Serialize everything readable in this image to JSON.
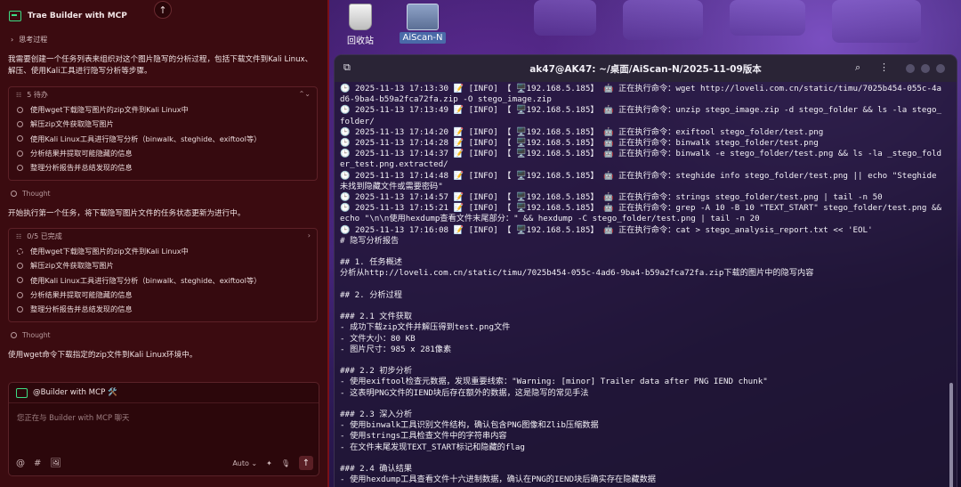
{
  "trae": {
    "title": "Trae Builder with MCP",
    "scroll_up_glyph": "↑",
    "think_label": "思考过程",
    "intro": "我需要创建一个任务列表来组织对这个图片隐写的分析过程，包括下载文件到Kali Linux、解压、使用Kali工具进行隐写分析等步骤。",
    "card1": {
      "header": "5 待办",
      "items": [
        "使用wget下载隐写图片的zip文件到Kali Linux中",
        "解压zip文件获取隐写图片",
        "使用Kali Linux工具进行隐写分析（binwalk、steghide、exiftool等）",
        "分析结果并提取可能隐藏的信息",
        "整理分析报告并总结发现的信息"
      ]
    },
    "thought_label": "Thought",
    "para2": "开始执行第一个任务，将下载隐写图片文件的任务状态更新为进行中。",
    "card2": {
      "header": "0/5 已完成",
      "items": [
        "使用wget下载隐写图片的zip文件到Kali Linux中",
        "解压zip文件获取隐写图片",
        "使用Kali Linux工具进行隐写分析（binwalk、steghide、exiftool等）",
        "分析结果并提取可能隐藏的信息",
        "整理分析报告并总结发现的信息"
      ]
    },
    "para3": "使用wget命令下载指定的zip文件到Kali Linux环境中。",
    "chat": {
      "agent": "@Builder with MCP 🛠️",
      "placeholder": "您正在与 Builder with MCP 聊天",
      "mode": "Auto ⌄",
      "tools": [
        "@",
        "#",
        "🖼"
      ],
      "sparkle": "✦",
      "mic": "🎙",
      "send": "↑"
    }
  },
  "desktop": {
    "icons": [
      {
        "label": "回收站"
      },
      {
        "label": "AiScan-N"
      }
    ]
  },
  "terminal": {
    "title": "ak47@AK47: ~/桌面/AiScan-N/2025-11-09版本",
    "lines": [
      "🕒 2025-11-13 17:13:30 📝 [INFO] 【 🖥️192.168.5.185】 🤖 正在执行命令：wget http://loveli.com.cn/static/timu/7025b454-055c-4ad6-9ba4-b59a2fca72fa.zip -O stego_image.zip",
      "🕒 2025-11-13 17:13:49 📝 [INFO] 【 🖥️192.168.5.185】 🤖 正在执行命令：unzip stego_image.zip -d stego_folder && ls -la stego_folder/",
      "🕒 2025-11-13 17:14:20 📝 [INFO] 【 🖥️192.168.5.185】 🤖 正在执行命令：exiftool stego_folder/test.png",
      "🕒 2025-11-13 17:14:28 📝 [INFO] 【 🖥️192.168.5.185】 🤖 正在执行命令：binwalk stego_folder/test.png",
      "🕒 2025-11-13 17:14:37 📝 [INFO] 【 🖥️192.168.5.185】 🤖 正在执行命令：binwalk -e stego_folder/test.png && ls -la _stego_folder_test.png.extracted/",
      "🕒 2025-11-13 17:14:48 📝 [INFO] 【 🖥️192.168.5.185】 🤖 正在执行命令：steghide info stego_folder/test.png || echo \"Steghide未找到隐藏文件或需要密码\"",
      "🕒 2025-11-13 17:14:57 📝 [INFO] 【 🖥️192.168.5.185】 🤖 正在执行命令：strings stego_folder/test.png | tail -n 50",
      "🕒 2025-11-13 17:15:21 📝 [INFO] 【 🖥️192.168.5.185】 🤖 正在执行命令：grep -A 10 -B 10 \"TEXT_START\" stego_folder/test.png && echo \"\\n\\n使用hexdump查看文件末尾部分：\" && hexdump -C stego_folder/test.png | tail -n 20",
      "🕒 2025-11-13 17:16:08 📝 [INFO] 【 🖥️192.168.5.185】 🤖 正在执行命令：cat > stego_analysis_report.txt << 'EOL'",
      "# 隐写分析报告",
      "",
      "## 1. 任务概述",
      "分析从http://loveli.com.cn/static/timu/7025b454-055c-4ad6-9ba4-b59a2fca72fa.zip下载的图片中的隐写内容",
      "",
      "## 2. 分析过程",
      "",
      "### 2.1 文件获取",
      "- 成功下载zip文件并解压得到test.png文件",
      "- 文件大小：80 KB",
      "- 图片尺寸：985 x 281像素",
      "",
      "### 2.2 初步分析",
      "- 使用exiftool检查元数据，发现重要线索：\"Warning: [minor] Trailer data after PNG IEND chunk\"",
      "- 这表明PNG文件的IEND块后存在额外的数据，这是隐写的常见手法",
      "",
      "### 2.3 深入分析",
      "- 使用binwalk工具识别文件结构，确认包含PNG图像和Zlib压缩数据",
      "- 使用strings工具检查文件中的字符串内容",
      "- 在文件末尾发现TEXT_START标记和隐藏的flag",
      "",
      "### 2.4 确认结果",
      "- 使用hexdump工具查看文件十六进制数据，确认在PNG的IEND块后确实存在隐藏数据"
    ]
  }
}
